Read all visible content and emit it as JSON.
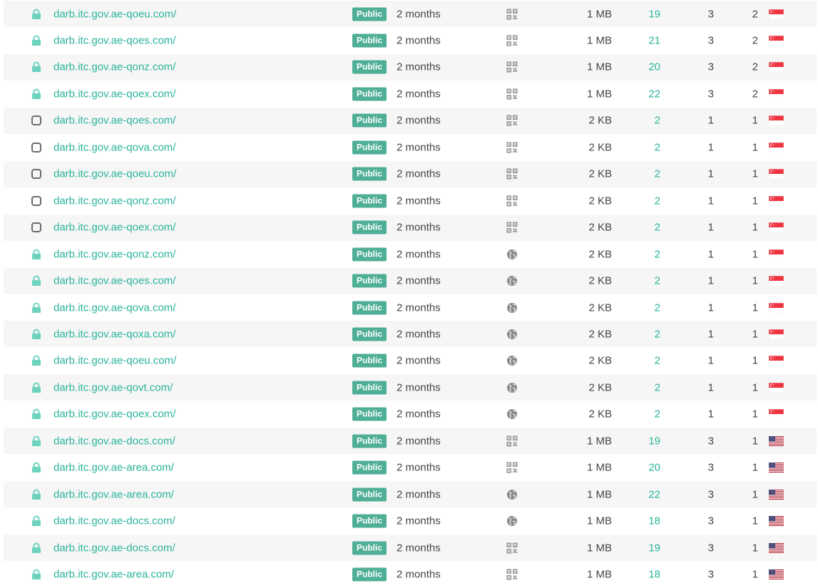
{
  "badge_label": "Public",
  "rows": [
    {
      "url": "darb.itc.gov.ae-qoeu.com/",
      "secure": true,
      "age": "2 months",
      "type": "qr",
      "size": "1 MB",
      "links": "19",
      "ips": "3",
      "countries": "2",
      "flag": "sg"
    },
    {
      "url": "darb.itc.gov.ae-qoes.com/",
      "secure": true,
      "age": "2 months",
      "type": "qr",
      "size": "1 MB",
      "links": "21",
      "ips": "3",
      "countries": "2",
      "flag": "sg"
    },
    {
      "url": "darb.itc.gov.ae-qonz.com/",
      "secure": true,
      "age": "2 months",
      "type": "qr",
      "size": "1 MB",
      "links": "20",
      "ips": "3",
      "countries": "2",
      "flag": "sg"
    },
    {
      "url": "darb.itc.gov.ae-qoex.com/",
      "secure": true,
      "age": "2 months",
      "type": "qr",
      "size": "1 MB",
      "links": "22",
      "ips": "3",
      "countries": "2",
      "flag": "sg"
    },
    {
      "url": "darb.itc.gov.ae-qoes.com/",
      "secure": false,
      "age": "2 months",
      "type": "qr",
      "size": "2 KB",
      "links": "2",
      "ips": "1",
      "countries": "1",
      "flag": "sg"
    },
    {
      "url": "darb.itc.gov.ae-qova.com/",
      "secure": false,
      "age": "2 months",
      "type": "qr",
      "size": "2 KB",
      "links": "2",
      "ips": "1",
      "countries": "1",
      "flag": "sg"
    },
    {
      "url": "darb.itc.gov.ae-qoeu.com/",
      "secure": false,
      "age": "2 months",
      "type": "qr",
      "size": "2 KB",
      "links": "2",
      "ips": "1",
      "countries": "1",
      "flag": "sg"
    },
    {
      "url": "darb.itc.gov.ae-qonz.com/",
      "secure": false,
      "age": "2 months",
      "type": "qr",
      "size": "2 KB",
      "links": "2",
      "ips": "1",
      "countries": "1",
      "flag": "sg"
    },
    {
      "url": "darb.itc.gov.ae-qoex.com/",
      "secure": false,
      "age": "2 months",
      "type": "qr",
      "size": "2 KB",
      "links": "2",
      "ips": "1",
      "countries": "1",
      "flag": "sg"
    },
    {
      "url": "darb.itc.gov.ae-qonz.com/",
      "secure": true,
      "age": "2 months",
      "type": "globe",
      "size": "2 KB",
      "links": "2",
      "ips": "1",
      "countries": "1",
      "flag": "sg"
    },
    {
      "url": "darb.itc.gov.ae-qoes.com/",
      "secure": true,
      "age": "2 months",
      "type": "globe",
      "size": "2 KB",
      "links": "2",
      "ips": "1",
      "countries": "1",
      "flag": "sg"
    },
    {
      "url": "darb.itc.gov.ae-qova.com/",
      "secure": true,
      "age": "2 months",
      "type": "globe",
      "size": "2 KB",
      "links": "2",
      "ips": "1",
      "countries": "1",
      "flag": "sg"
    },
    {
      "url": "darb.itc.gov.ae-qoxa.com/",
      "secure": true,
      "age": "2 months",
      "type": "globe",
      "size": "2 KB",
      "links": "2",
      "ips": "1",
      "countries": "1",
      "flag": "sg"
    },
    {
      "url": "darb.itc.gov.ae-qoeu.com/",
      "secure": true,
      "age": "2 months",
      "type": "globe",
      "size": "2 KB",
      "links": "2",
      "ips": "1",
      "countries": "1",
      "flag": "sg"
    },
    {
      "url": "darb.itc.gov.ae-qovt.com/",
      "secure": true,
      "age": "2 months",
      "type": "globe",
      "size": "2 KB",
      "links": "2",
      "ips": "1",
      "countries": "1",
      "flag": "sg"
    },
    {
      "url": "darb.itc.gov.ae-qoex.com/",
      "secure": true,
      "age": "2 months",
      "type": "globe",
      "size": "2 KB",
      "links": "2",
      "ips": "1",
      "countries": "1",
      "flag": "sg"
    },
    {
      "url": "darb.itc.gov.ae-docs.com/",
      "secure": true,
      "age": "2 months",
      "type": "qr",
      "size": "1 MB",
      "links": "19",
      "ips": "3",
      "countries": "1",
      "flag": "us"
    },
    {
      "url": "darb.itc.gov.ae-area.com/",
      "secure": true,
      "age": "2 months",
      "type": "qr",
      "size": "1 MB",
      "links": "20",
      "ips": "3",
      "countries": "1",
      "flag": "us"
    },
    {
      "url": "darb.itc.gov.ae-area.com/",
      "secure": true,
      "age": "2 months",
      "type": "globe",
      "size": "1 MB",
      "links": "22",
      "ips": "3",
      "countries": "1",
      "flag": "us"
    },
    {
      "url": "darb.itc.gov.ae-docs.com/",
      "secure": true,
      "age": "2 months",
      "type": "globe",
      "size": "1 MB",
      "links": "18",
      "ips": "3",
      "countries": "1",
      "flag": "us"
    },
    {
      "url": "darb.itc.gov.ae-docs.com/",
      "secure": true,
      "age": "2 months",
      "type": "qr",
      "size": "1 MB",
      "links": "19",
      "ips": "3",
      "countries": "1",
      "flag": "us"
    },
    {
      "url": "darb.itc.gov.ae-area.com/",
      "secure": true,
      "age": "2 months",
      "type": "qr",
      "size": "1 MB",
      "links": "18",
      "ips": "3",
      "countries": "1",
      "flag": "us"
    }
  ],
  "colors": {
    "link": "#2bb39a",
    "badge": "#4fae96",
    "lock_secure": "#6dd3be",
    "lock_open": "#6b6b6b",
    "icon_gray": "#8a8a8a",
    "stripe": "#f6f6f6"
  },
  "icons": {
    "secure": "lock-icon",
    "insecure": "unlocked-square-icon",
    "qr": "qr-code-icon",
    "globe": "globe-icon",
    "sg": "singapore-flag-icon",
    "us": "us-flag-icon"
  }
}
